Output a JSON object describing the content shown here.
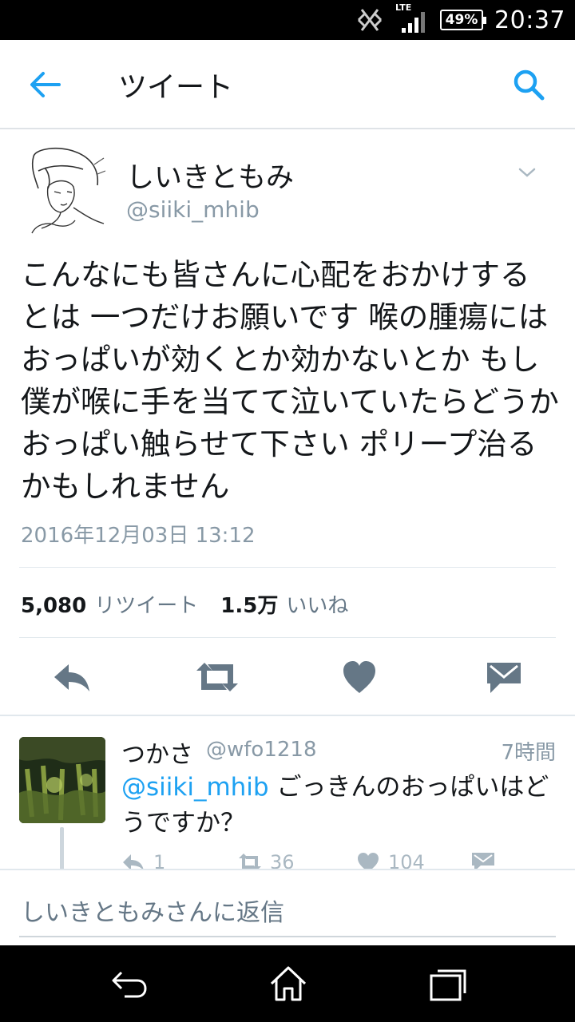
{
  "status_bar": {
    "time": "20:37",
    "battery_percent_label": "49%",
    "battery_level": 0.49,
    "network_label": "LTE",
    "icons": [
      "nfc-off-icon",
      "lte-signal-icon",
      "battery-icon"
    ]
  },
  "app_bar": {
    "title": "ツイート",
    "back_icon": "arrow-left-icon",
    "search_icon": "search-icon",
    "accent_color": "#1da1f2"
  },
  "tweet": {
    "display_name": "しいきともみ",
    "handle": "@siiki_mhib",
    "text": "こんなにも皆さんに心配をおかけするとは 一つだけお願いです 喉の腫瘍にはおっぱいが効くとか効かないとか もし僕が喉に手を当てて泣いていたらどうかおっぱい触らせて下さい ポリープ治るかもしれません",
    "timestamp": "2016年12月03日 13:12",
    "retweet_count": "5,080",
    "retweet_label": "リツイート",
    "like_count": "1.5万",
    "like_label": "いいね",
    "actions": [
      "reply-icon",
      "retweet-icon",
      "heart-icon",
      "dm-icon"
    ]
  },
  "reply": {
    "display_name": "つかさ",
    "handle": "@wfo1218",
    "time_ago": "7時間",
    "mention": "@siiki_mhib",
    "text": "ごっきんのおっぱいはどうですか？",
    "reply_count": "1",
    "retweet_count": "36",
    "like_count": "104"
  },
  "composer": {
    "placeholder": "しいきともみさんに返信"
  },
  "nav_bar": {
    "icons": [
      "nav-back-icon",
      "nav-home-icon",
      "nav-recents-icon"
    ]
  }
}
